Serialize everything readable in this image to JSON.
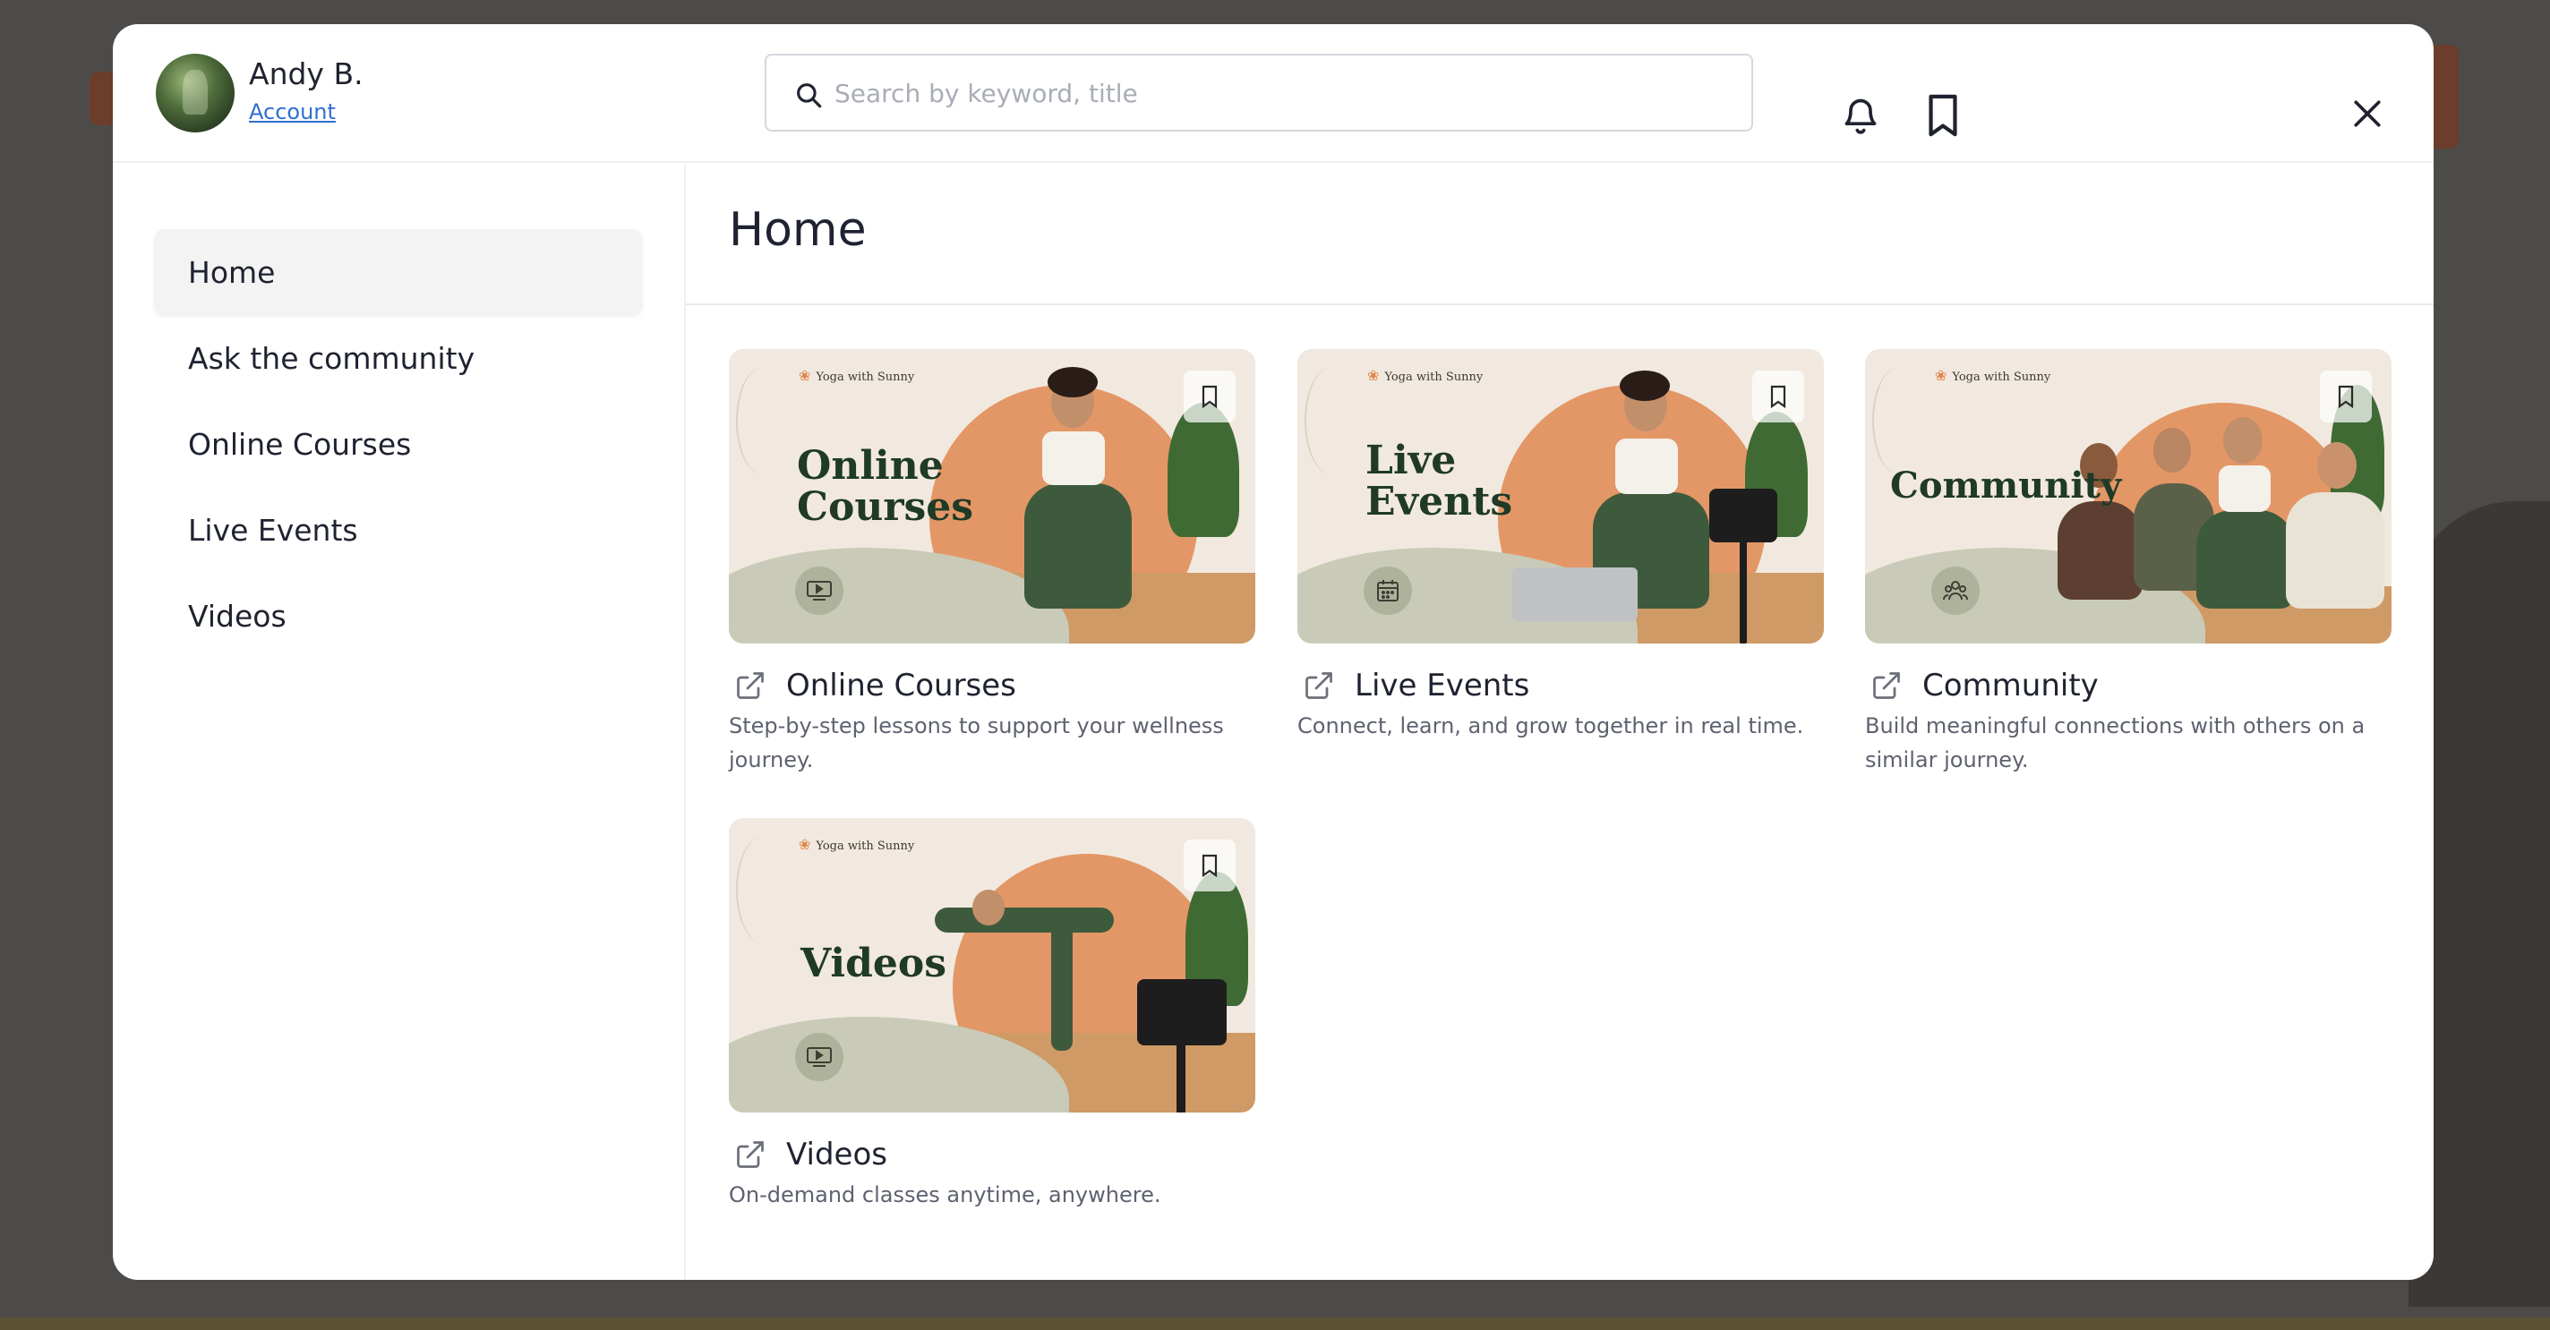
{
  "user": {
    "name": "Andy B.",
    "account_label": "Account"
  },
  "search": {
    "placeholder": "Search by keyword, title",
    "value": ""
  },
  "sidebar": {
    "items": [
      {
        "label": "Home",
        "active": true
      },
      {
        "label": "Ask the community",
        "active": false
      },
      {
        "label": "Online Courses",
        "active": false
      },
      {
        "label": "Live Events",
        "active": false
      },
      {
        "label": "Videos",
        "active": false
      }
    ]
  },
  "main": {
    "title": "Home",
    "cards": [
      {
        "title": "Online Courses",
        "description": "Step-by-step lessons to support your wellness journey.",
        "thumb_brand": "Yoga with Sunny",
        "thumb_label": "Online\nCourses",
        "badge_icon": "video-play-icon"
      },
      {
        "title": "Live Events",
        "description": "Connect, learn, and grow together in real time.",
        "thumb_brand": "Yoga with Sunny",
        "thumb_label": "Live\nEvents",
        "badge_icon": "calendar-icon"
      },
      {
        "title": "Community",
        "description": "Build meaningful connections with others on a similar journey.",
        "thumb_brand": "Yoga with Sunny",
        "thumb_label": "Community",
        "badge_icon": "people-icon"
      },
      {
        "title": "Videos",
        "description": "On-demand classes anytime, anywhere.",
        "thumb_brand": "Yoga with Sunny",
        "thumb_label": "Videos",
        "badge_icon": "video-play-icon"
      }
    ]
  },
  "colors": {
    "accent_link": "#2f6fd1",
    "brand_orange": "#e39766",
    "brand_green": "#1f3a26",
    "text_primary": "#1f2230",
    "text_secondary": "#5e6270"
  },
  "icons": {
    "search": "search-icon",
    "notifications": "bell-icon",
    "saved": "bookmark-icon",
    "close": "close-icon",
    "open_external": "external-link-icon"
  }
}
